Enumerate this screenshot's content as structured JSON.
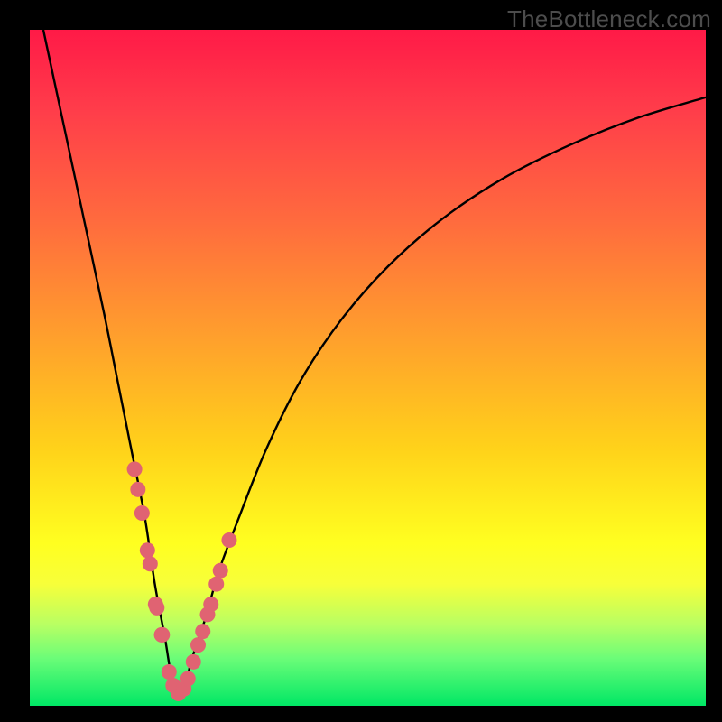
{
  "watermark": "TheBottleneck.com",
  "colors": {
    "background_frame": "#000000",
    "gradient_top": "#ff1a47",
    "gradient_bottom": "#00e765",
    "curve": "#000000",
    "dots": "#e06372"
  },
  "chart_data": {
    "type": "line",
    "title": "",
    "xlabel": "",
    "ylabel": "",
    "xlim": [
      0,
      100
    ],
    "ylim": [
      0,
      100
    ],
    "description": "V-shaped bottleneck curve. Color gradient encodes severity: red at top (high bottleneck), green at bottom (balanced). Minimum of curve is near x≈22.",
    "series": [
      {
        "name": "bottleneck-curve",
        "x": [
          2,
          5,
          8,
          11,
          13,
          15,
          17,
          18.5,
          20,
          21,
          22,
          23,
          24,
          26,
          28,
          31,
          35,
          40,
          46,
          53,
          61,
          70,
          80,
          90,
          100
        ],
        "y": [
          100,
          86,
          72,
          58,
          48,
          38,
          28,
          18,
          10,
          4,
          1,
          3,
          7,
          13,
          20,
          28,
          38,
          48,
          57,
          65,
          72,
          78,
          83,
          87,
          90
        ]
      }
    ],
    "highlight_points": {
      "name": "sample-dots",
      "x": [
        15.5,
        16.0,
        16.6,
        17.4,
        17.8,
        18.6,
        18.8,
        19.5,
        19.6,
        20.6,
        21.2,
        22.0,
        22.8,
        23.4,
        24.2,
        24.9,
        25.6,
        26.3,
        26.8,
        27.6,
        28.2,
        29.5
      ],
      "y": [
        35.0,
        32.0,
        28.5,
        23.0,
        21.0,
        15.0,
        14.5,
        10.5,
        10.5,
        5.0,
        3.0,
        1.8,
        2.5,
        4.0,
        6.5,
        9.0,
        11.0,
        13.5,
        15.0,
        18.0,
        20.0,
        24.5
      ]
    }
  }
}
